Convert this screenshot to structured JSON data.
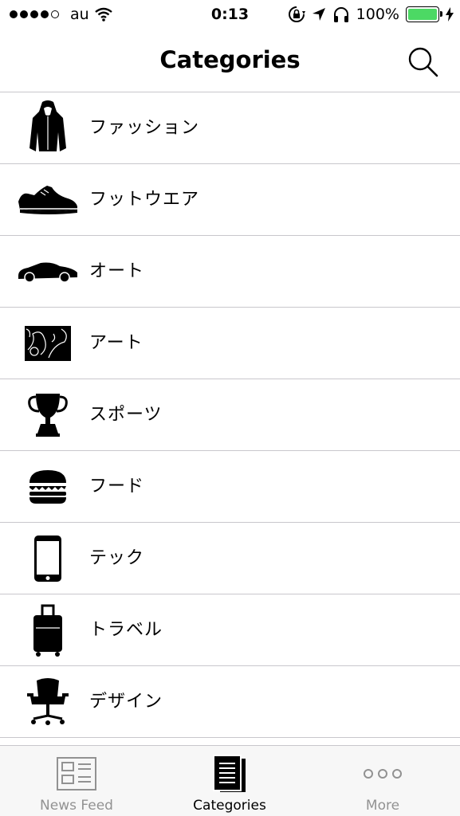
{
  "status_bar": {
    "carrier": "au",
    "time": "0:13",
    "battery_percent": "100%",
    "battery_level": 1.0,
    "battery_color": "#4cd964",
    "signal_bars_filled": 4,
    "signal_bars_total": 5
  },
  "nav": {
    "title": "Categories",
    "search_icon": "search-icon"
  },
  "categories": [
    {
      "label": "ファッション",
      "icon": "hoodie-icon"
    },
    {
      "label": "フットウエア",
      "icon": "sneaker-icon"
    },
    {
      "label": "オート",
      "icon": "car-icon"
    },
    {
      "label": "アート",
      "icon": "art-icon"
    },
    {
      "label": "スポーツ",
      "icon": "trophy-icon"
    },
    {
      "label": "フード",
      "icon": "burger-icon"
    },
    {
      "label": "テック",
      "icon": "phone-icon"
    },
    {
      "label": "トラベル",
      "icon": "suitcase-icon"
    },
    {
      "label": "デザイン",
      "icon": "chair-icon"
    }
  ],
  "tab_bar": {
    "tabs": [
      {
        "label": "News Feed",
        "icon": "news-feed-icon",
        "active": false
      },
      {
        "label": "Categories",
        "icon": "categories-icon",
        "active": true
      },
      {
        "label": "More",
        "icon": "more-icon",
        "active": false
      }
    ]
  }
}
